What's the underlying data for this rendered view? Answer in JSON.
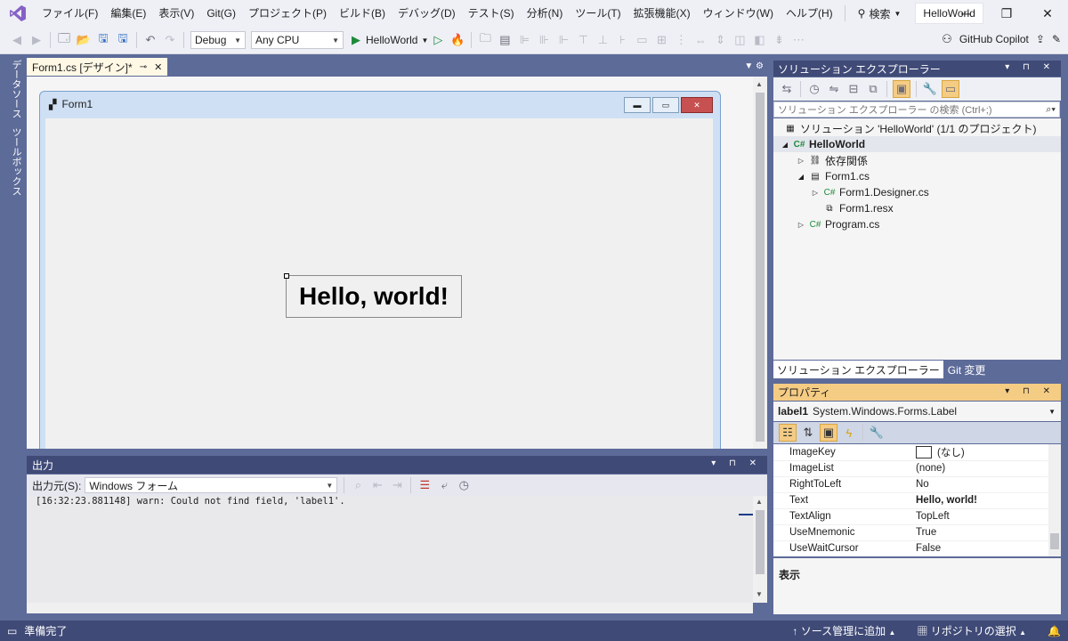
{
  "menubar": {
    "items": [
      "ファイル(F)",
      "編集(E)",
      "表示(V)",
      "Git(G)",
      "プロジェクト(P)",
      "ビルド(B)",
      "デバッグ(D)",
      "テスト(S)",
      "分析(N)",
      "ツール(T)",
      "拡張機能(X)",
      "ウィンドウ(W)",
      "ヘルプ(H)"
    ],
    "search_label": "検索",
    "solution_name": "HelloWorld"
  },
  "toolbar": {
    "config": "Debug",
    "platform": "Any CPU",
    "run_label": "HelloWorld",
    "copilot_label": "GitHub Copilot"
  },
  "left_tabs": [
    "データソース",
    "ツールボックス"
  ],
  "document": {
    "tab_title": "Form1.cs [デザイン]*",
    "form_title": "Form1",
    "label_text": "Hello, world!"
  },
  "output": {
    "title": "出力",
    "source_label": "出力元(S):",
    "source_value": "Windows フォーム",
    "lines": [
      "[16:32:23.881148] warn: Could not find field, 'label1'."
    ]
  },
  "solution_explorer": {
    "title": "ソリューション エクスプローラー",
    "search_placeholder": "ソリューション エクスプローラー の検索 (Ctrl+;)",
    "nodes": [
      {
        "label": "ソリューション 'HelloWorld' (1/1 のプロジェクト)",
        "icon": "solution-icon"
      },
      {
        "label": "HelloWorld",
        "icon": "csharp-project-icon"
      },
      {
        "label": "依存関係",
        "icon": "dependencies-icon"
      },
      {
        "label": "Form1.cs",
        "icon": "form-icon"
      },
      {
        "label": "Form1.Designer.cs",
        "icon": "csharp-file-icon"
      },
      {
        "label": "Form1.resx",
        "icon": "resx-file-icon"
      },
      {
        "label": "Program.cs",
        "icon": "csharp-file-icon"
      }
    ],
    "tabs": [
      "ソリューション エクスプローラー",
      "Git 変更"
    ]
  },
  "properties": {
    "title": "プロパティ",
    "object_name": "label1",
    "object_type": "System.Windows.Forms.Label",
    "rows": [
      {
        "name": "ImageKey",
        "value": "(なし)"
      },
      {
        "name": "ImageList",
        "value": "(none)"
      },
      {
        "name": "RightToLeft",
        "value": "No"
      },
      {
        "name": "Text",
        "value": "Hello, world!"
      },
      {
        "name": "TextAlign",
        "value": "TopLeft"
      },
      {
        "name": "UseMnemonic",
        "value": "True"
      },
      {
        "name": "UseWaitCursor",
        "value": "False"
      }
    ],
    "description_title": "表示"
  },
  "status": {
    "ready": "準備完了",
    "source_control": "ソース管理に追加",
    "repo_select": "リポジトリの選択"
  },
  "colors": {
    "frame": "#5d6b99",
    "panel_header": "#3f4a77",
    "properties_header": "#f5cc84",
    "doc_tab": "#fff8e5",
    "vs_purple": "#8661c5"
  }
}
